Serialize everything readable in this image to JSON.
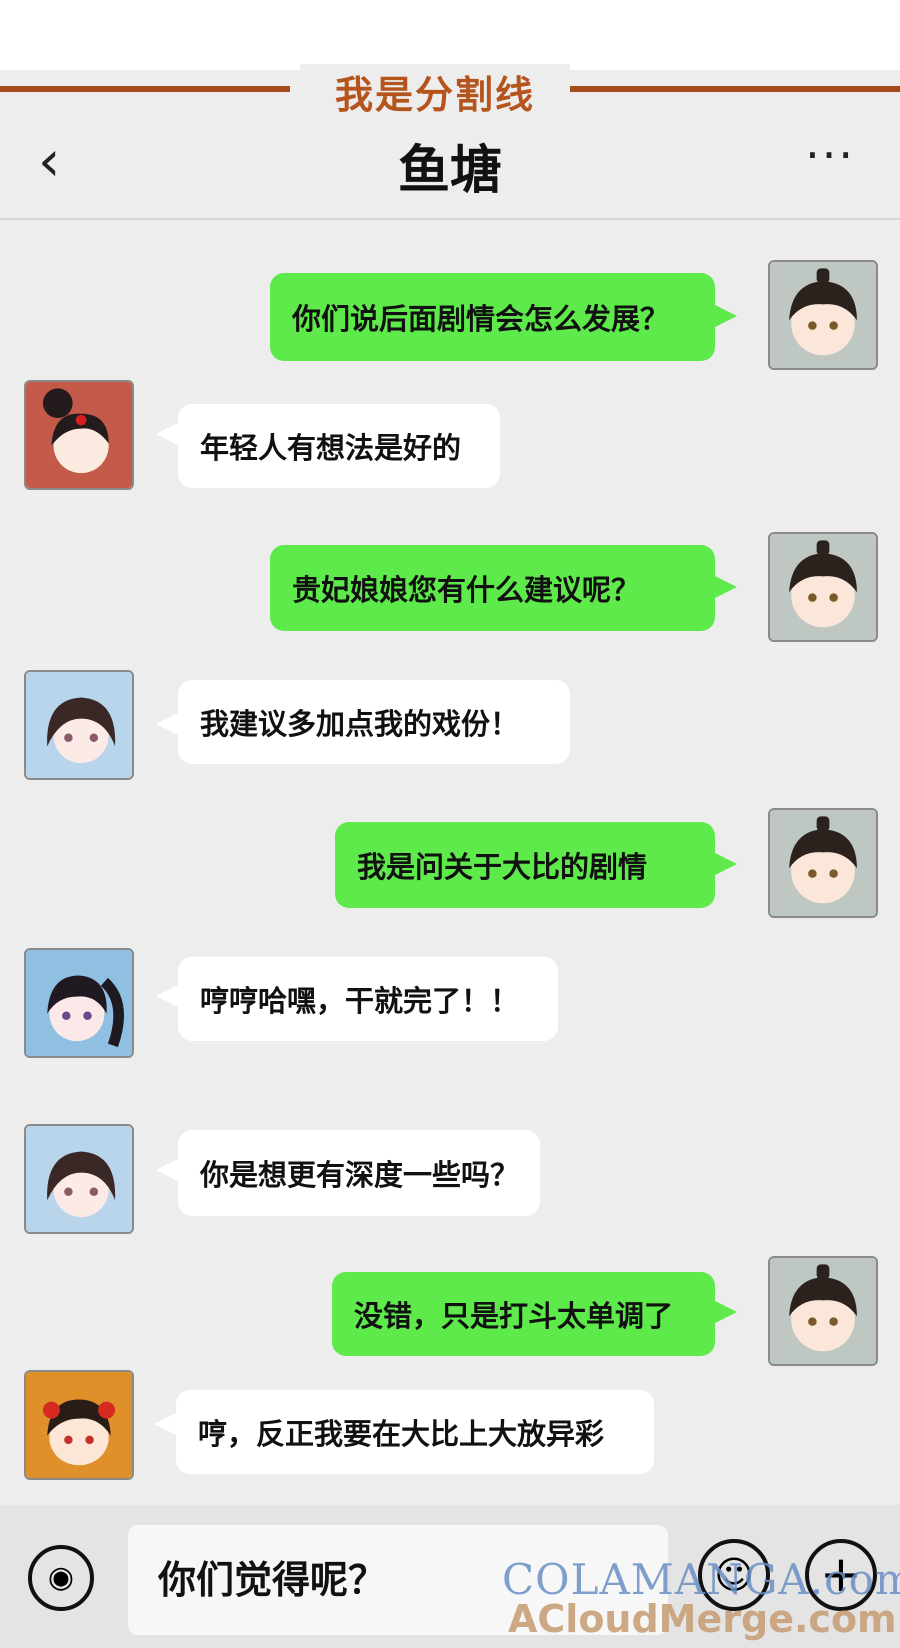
{
  "divider": {
    "label": "我是分割线"
  },
  "header": {
    "title": "鱼塘",
    "back_icon": "chevron-left-icon",
    "more_icon": "more-dots-icon"
  },
  "messages": [
    {
      "side": "right",
      "text": "你们说后面剧情会怎么发展？",
      "avatar": "protagonist-avatar"
    },
    {
      "side": "left",
      "text": "年轻人有想法是好的",
      "avatar": "red-hair-avatar"
    },
    {
      "side": "right",
      "text": "贵妃娘娘您有什么建议呢？",
      "avatar": "protagonist-avatar"
    },
    {
      "side": "left",
      "text": "我建议多加点我的戏份！",
      "avatar": "consort-avatar"
    },
    {
      "side": "right",
      "text": "我是问关于大比的剧情",
      "avatar": "protagonist-avatar"
    },
    {
      "side": "left",
      "text": "哼哼哈嘿，干就完了！！",
      "avatar": "ponytail-avatar"
    },
    {
      "side": "left",
      "text": "你是想更有深度一些吗？",
      "avatar": "consort-avatar"
    },
    {
      "side": "right",
      "text": "没错，只是打斗太单调了",
      "avatar": "protagonist-avatar"
    },
    {
      "side": "left",
      "text": "哼，反正我要在大比上大放异彩",
      "avatar": "flower-hair-avatar"
    }
  ],
  "footer": {
    "input_text": "你们觉得呢？",
    "voice_icon": "voice-icon",
    "emoji_icon": "emoji-icon",
    "plus_icon": "plus-icon"
  },
  "watermark": {
    "line1": "COLAMANGA.com",
    "line2": "ACloudMerge.com"
  },
  "colors": {
    "accent": "#a64a1a",
    "bubble_right": "#5dea4a",
    "bubble_left": "#ffffff",
    "background": "#ededed"
  }
}
